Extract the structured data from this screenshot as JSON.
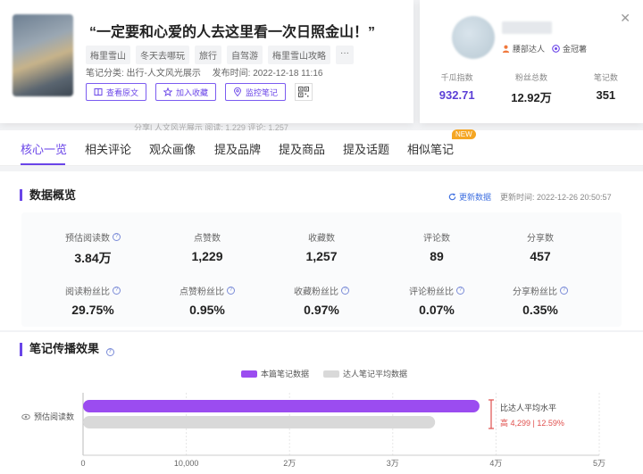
{
  "note": {
    "title": "“一定要和心爱的人去这里看一次日照金山！”",
    "tags": [
      "梅里雪山",
      "冬天去哪玩",
      "旅行",
      "自驾游",
      "梅里雪山攻略",
      "···"
    ],
    "category": "笔记分类: 出行-人文风光展示",
    "publish_time": "发布时间: 2022-12-18 11:16",
    "actions": {
      "view_original": "查看原文",
      "add_favorite": "加入收藏",
      "monitor": "监控笔记"
    },
    "under_strip": "分享| 人文风光展示        阅读: 1,229    评论: 1,257"
  },
  "author": {
    "badge_1": "腰部达人",
    "badge_2": "金冠薯",
    "stats": [
      {
        "label": "千瓜指数",
        "value": "932.71"
      },
      {
        "label": "粉丝总数",
        "value": "12.92万"
      },
      {
        "label": "笔记数",
        "value": "351"
      }
    ]
  },
  "tabs": [
    "核心一览",
    "相关评论",
    "观众画像",
    "提及品牌",
    "提及商品",
    "提及话题",
    "相似笔记"
  ],
  "new_badge": "NEW",
  "overview": {
    "title": "数据概览",
    "refresh": "更新数据",
    "update_time": "更新时间: 2022-12-26 20:50:57",
    "metrics": [
      {
        "label": "预估阅读数",
        "value": "3.84万",
        "help": true
      },
      {
        "label": "点赞数",
        "value": "1,229",
        "help": false
      },
      {
        "label": "收藏数",
        "value": "1,257",
        "help": false
      },
      {
        "label": "评论数",
        "value": "89",
        "help": false
      },
      {
        "label": "分享数",
        "value": "457",
        "help": false
      },
      {
        "label": "阅读粉丝比",
        "value": "29.75%",
        "help": true
      },
      {
        "label": "点赞粉丝比",
        "value": "0.95%",
        "help": true
      },
      {
        "label": "收藏粉丝比",
        "value": "0.97%",
        "help": true
      },
      {
        "label": "评论粉丝比",
        "value": "0.07%",
        "help": true
      },
      {
        "label": "分享粉丝比",
        "value": "0.35%",
        "help": true
      }
    ]
  },
  "spread": {
    "title": "笔记传播效果",
    "compare_line1": "比达人平均水平",
    "compare_line2": "高 4,299 | 12.59%"
  },
  "chart_data": {
    "type": "bar",
    "orientation": "horizontal",
    "categories": [
      "预估阅读数"
    ],
    "series": [
      {
        "name": "本篇笔记数据",
        "values": [
          38400
        ],
        "color": "#9b4cf0"
      },
      {
        "name": "达人笔记平均数据",
        "values": [
          34100
        ],
        "color": "#d9d9d9"
      }
    ],
    "xlim": [
      0,
      50000
    ],
    "ticks": [
      0,
      10000,
      20000,
      30000,
      40000,
      50000
    ],
    "tick_labels": [
      "0",
      "10,000",
      "2万",
      "3万",
      "4万",
      "5万"
    ],
    "grid": true,
    "legend": "top-center"
  }
}
